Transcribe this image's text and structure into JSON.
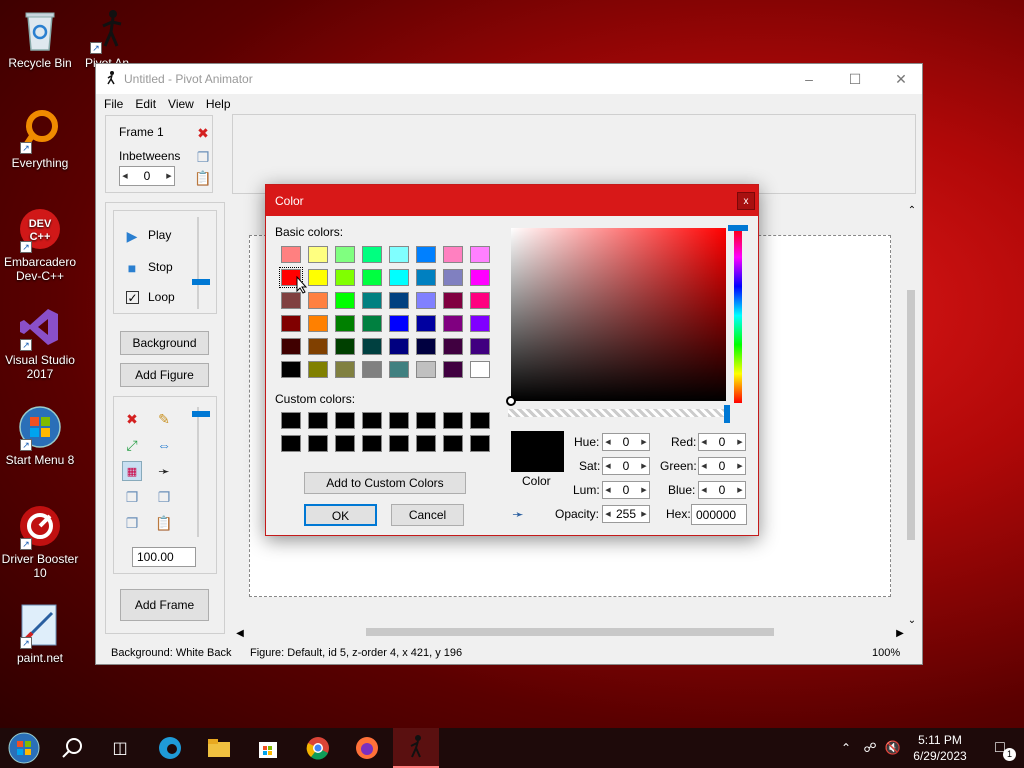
{
  "desktop": {
    "icons": [
      {
        "label": "Recycle Bin"
      },
      {
        "label": "Everything"
      },
      {
        "label": "Embarcadero Dev-C++"
      },
      {
        "label": "Visual Studio 2017"
      },
      {
        "label": "Start Menu 8"
      },
      {
        "label": "Driver Booster 10"
      },
      {
        "label": "paint.net"
      }
    ],
    "partial_label": "Pivot An"
  },
  "window": {
    "title": "Untitled - Pivot Animator",
    "menu": [
      "File",
      "Edit",
      "View",
      "Help"
    ],
    "frame_label": "Frame 1",
    "inbetweens_label": "Inbetweens",
    "inbetweens_value": "0",
    "play_label": "Play",
    "stop_label": "Stop",
    "loop_label": "Loop",
    "loop_checked": true,
    "background_button": "Background",
    "add_figure_button": "Add Figure",
    "scale_value": "100.00",
    "add_frame_button": "Add Frame",
    "status": {
      "background": "Background: White Back",
      "figure": "Figure: Default,  id 5,  z-order 4,  x 421, y 196",
      "zoom": "100%"
    }
  },
  "color_dialog": {
    "title": "Color",
    "close_label": "x",
    "basic_colors_label": "Basic colors:",
    "basic_colors": [
      [
        "#ff8080",
        "#ffff80",
        "#80ff80",
        "#00ff80",
        "#80ffff",
        "#0080ff",
        "#ff80c0",
        "#ff80ff"
      ],
      [
        "#ff0000",
        "#ffff00",
        "#80ff00",
        "#00ff40",
        "#00ffff",
        "#0080c0",
        "#8080c0",
        "#ff00ff"
      ],
      [
        "#804040",
        "#ff8040",
        "#00ff00",
        "#008080",
        "#004080",
        "#8080ff",
        "#800040",
        "#ff0080"
      ],
      [
        "#800000",
        "#ff8000",
        "#008000",
        "#008040",
        "#0000ff",
        "#0000a0",
        "#800080",
        "#8000ff"
      ],
      [
        "#400000",
        "#804000",
        "#004000",
        "#004040",
        "#000080",
        "#000040",
        "#400040",
        "#400080"
      ],
      [
        "#000000",
        "#808000",
        "#808040",
        "#808080",
        "#408080",
        "#c0c0c0",
        "#400040",
        "#ffffff"
      ]
    ],
    "custom_colors_label": "Custom colors:",
    "custom_colors": [
      [
        "#000000",
        "#000000",
        "#000000",
        "#000000",
        "#000000",
        "#000000",
        "#000000",
        "#000000"
      ],
      [
        "#000000",
        "#000000",
        "#000000",
        "#000000",
        "#000000",
        "#000000",
        "#000000",
        "#000000"
      ]
    ],
    "add_custom_label": "Add to Custom Colors",
    "ok_label": "OK",
    "cancel_label": "Cancel",
    "color_preview_label": "Color",
    "preview_color": "#000000",
    "hue_label": "Hue:",
    "hue": "0",
    "sat_label": "Sat:",
    "sat": "0",
    "lum_label": "Lum:",
    "lum": "0",
    "opacity_label": "Opacity:",
    "opacity": "255",
    "red_label": "Red:",
    "red": "0",
    "green_label": "Green:",
    "green": "0",
    "blue_label": "Blue:",
    "blue": "0",
    "hex_label": "Hex:",
    "hex": "000000"
  },
  "taskbar": {
    "time": "5:11 PM",
    "date": "6/29/2023",
    "notification_count": "1"
  }
}
